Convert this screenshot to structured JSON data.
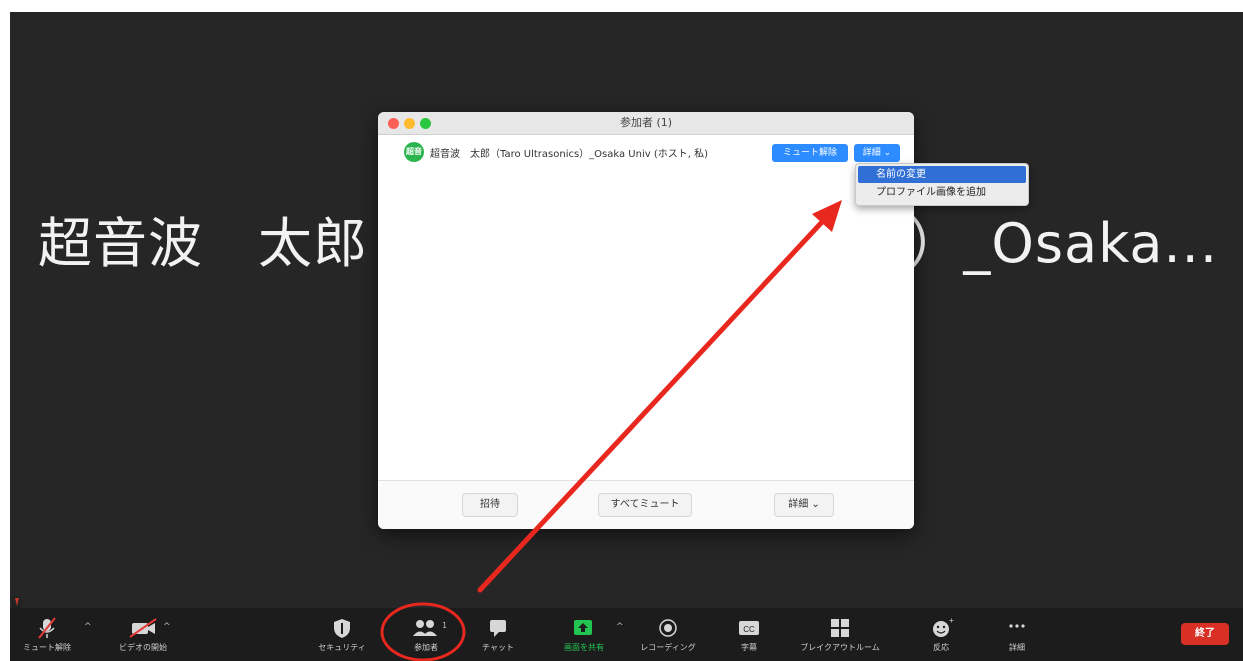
{
  "background": {
    "name_left": "超音波　太郎",
    "name_right": "）_Osaka..."
  },
  "window": {
    "title": "参加者 (1)",
    "participant": {
      "avatar_text": "超音",
      "name": "超音波　太郎（Taro Ultrasonics）_Osaka Univ (ホスト, 私)",
      "unmute_label": "ミュート解除",
      "more_label": "詳細"
    },
    "footer": {
      "invite_label": "招待",
      "mute_all_label": "すべてミュート",
      "more_label": "詳細"
    }
  },
  "context_menu": {
    "items": [
      "名前の変更",
      "プロファイル画像を追加"
    ]
  },
  "toolbar": {
    "unmute_label": "ミュート解除",
    "start_video_label": "ビデオの開始",
    "security_label": "セキュリティ",
    "participants_label": "参加者",
    "participants_count": "1",
    "chat_label": "チャット",
    "share_label": "画面を共有",
    "record_label": "レコーディング",
    "captions_label": "字幕",
    "breakout_label": "ブレイクアウトルーム",
    "reactions_label": "反応",
    "more_label": "詳細",
    "end_label": "終了"
  },
  "colors": {
    "brand_blue": "#2d8cff",
    "end_red": "#d93025",
    "annotation_red": "#e8281f",
    "share_green": "#23c552",
    "avatar_green": "#2cb54f"
  }
}
